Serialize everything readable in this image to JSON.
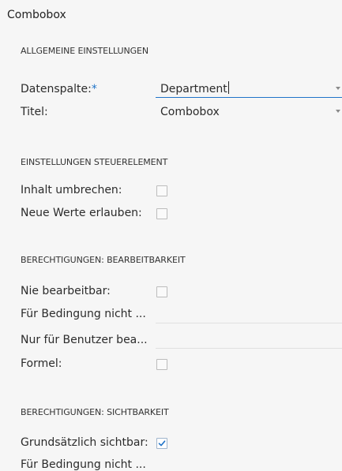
{
  "panel": {
    "title": "Combobox"
  },
  "sections": {
    "general": "ALLGEMEINE EINSTELLUNGEN",
    "control": "EINSTELLUNGEN STEUERELEMENT",
    "edit": "BERECHTIGUNGEN: BEARBEITBARKEIT",
    "visibility": "BERECHTIGUNGEN: SICHTBARKEIT"
  },
  "general": {
    "datenspalte_label": "Datenspalte:",
    "required_mark": "*",
    "datenspalte_value": "Department",
    "titel_label": "Titel:",
    "titel_value": "Combobox"
  },
  "control": {
    "wrap_label": "Inhalt umbrechen:",
    "wrap_checked": false,
    "allow_label": "Neue Werte erlauben:",
    "allow_checked": false
  },
  "edit": {
    "never_label": "Nie bearbeitbar:",
    "never_checked": false,
    "cond_label": "Für Bedingung nicht ...",
    "user_label": "Nur für Benutzer bea...",
    "formula_label": "Formel:",
    "formula_checked": false
  },
  "visibility": {
    "always_label": "Grundsätzlich sichtbar:",
    "always_checked": true,
    "cond_label": "Für Bedingung nicht ..."
  },
  "colors": {
    "accent": "#1f73c8",
    "required": "#1f73c8"
  }
}
